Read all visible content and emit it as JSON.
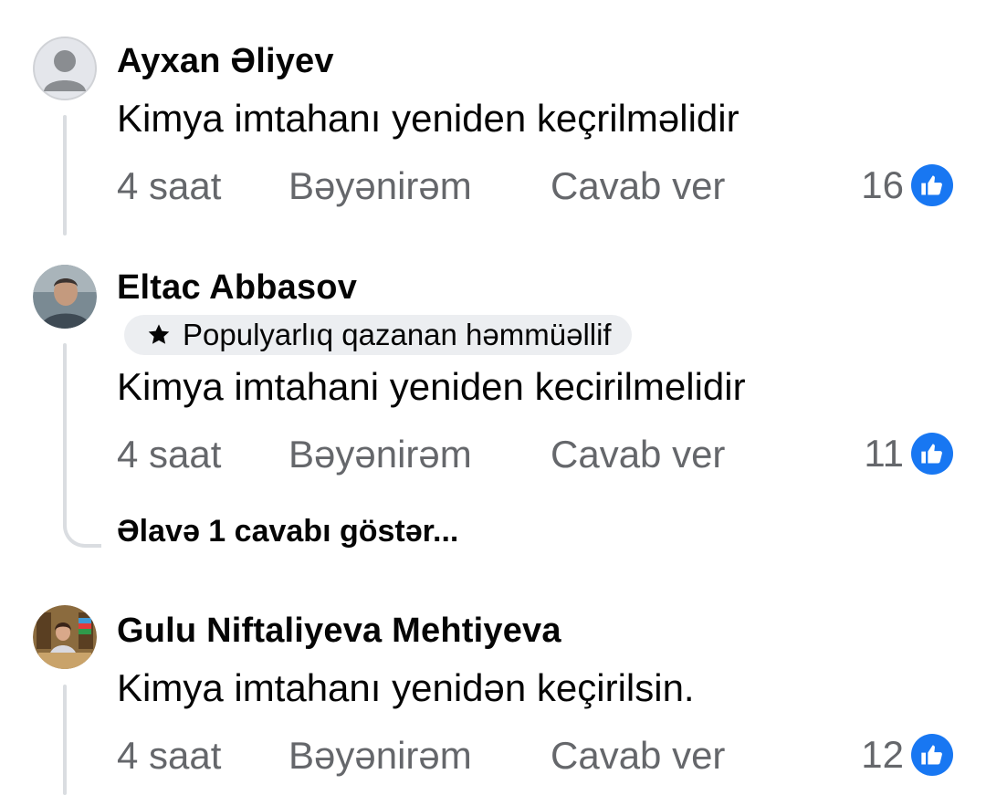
{
  "comments": [
    {
      "author": "Ayxan Əliyev",
      "avatar": "default-avatar",
      "text": "Kimya imtahanı yeniden keçrilməlidir",
      "time": "4 saat",
      "like_label": "Bəyənirəm",
      "reply_label": "Cavab ver",
      "reaction_count": "16"
    },
    {
      "author": "Eltac Abbasov",
      "avatar": "photo-avatar",
      "badge": "Populyarlıq qazanan həmmüəllif",
      "text": "Kimya imtahani yeniden kecirilmelidir",
      "time": "4 saat",
      "like_label": "Bəyənirəm",
      "reply_label": "Cavab ver",
      "reaction_count": "11",
      "more_replies": "Əlavə 1 cavabı göstər..."
    },
    {
      "author": "Gulu Niftaliyeva Mehtiyeva",
      "avatar": "photo-avatar",
      "text": "Kimya imtahanı yenidən keçirilsin.",
      "time": "4 saat",
      "like_label": "Bəyənirəm",
      "reply_label": "Cavab ver",
      "reaction_count": "12"
    }
  ],
  "colors": {
    "text_primary": "#050505",
    "text_secondary": "#65676b",
    "like_blue": "#1877f2",
    "thread_line": "#dadde1",
    "badge_bg": "#eceef1"
  },
  "icons": {
    "reaction": "like-thumb-icon",
    "badge": "star-icon"
  }
}
